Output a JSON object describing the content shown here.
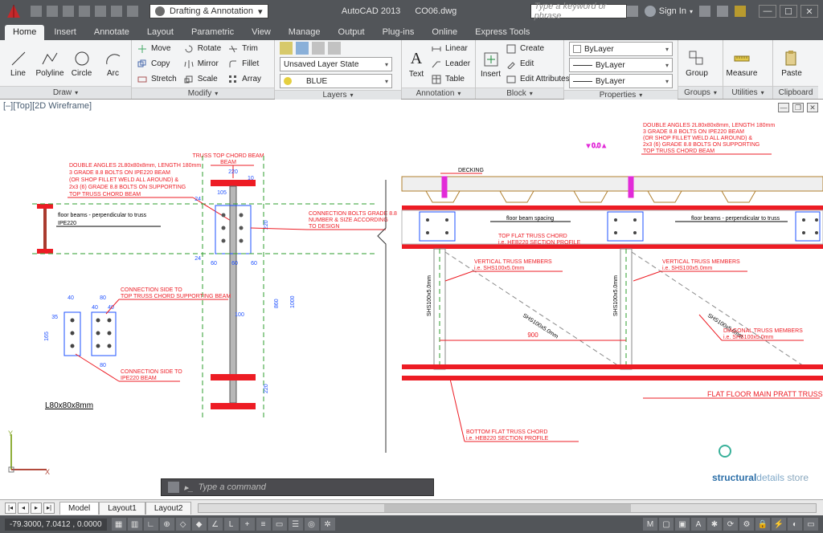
{
  "app": {
    "name": "AutoCAD 2013",
    "file": "CO06.dwg"
  },
  "workspace": {
    "label": "Drafting & Annotation"
  },
  "search": {
    "placeholder": "Type a keyword or phrase"
  },
  "signin": {
    "label": "Sign In"
  },
  "tabs": [
    "Home",
    "Insert",
    "Annotate",
    "Layout",
    "Parametric",
    "View",
    "Manage",
    "Output",
    "Plug-ins",
    "Online",
    "Express Tools"
  ],
  "active_tab": 0,
  "ribbon": {
    "draw": {
      "title": "Draw",
      "items": [
        "Line",
        "Polyline",
        "Circle",
        "Arc"
      ]
    },
    "modify": {
      "title": "Modify",
      "col1": [
        "Move",
        "Copy",
        "Stretch"
      ],
      "col2": [
        "Rotate",
        "Mirror",
        "Scale"
      ],
      "col3": [
        "Trim",
        "Fillet",
        "Array"
      ]
    },
    "layers": {
      "title": "Layers",
      "state": "Unsaved Layer State",
      "current": "BLUE",
      "swatch": "#1e50ff"
    },
    "annotation": {
      "title": "Annotation",
      "big": "Text",
      "rows": [
        "Linear",
        "Leader",
        "Table"
      ]
    },
    "block": {
      "title": "Block",
      "big": "Insert",
      "rows": [
        "Create",
        "Edit",
        "Edit Attributes"
      ]
    },
    "properties": {
      "title": "Properties",
      "combo1": "ByLayer",
      "combo2": "ByLayer",
      "combo3": "ByLayer"
    },
    "groups": {
      "title": "Groups",
      "big": "Group"
    },
    "utilities": {
      "title": "Utilities",
      "big": "Measure"
    },
    "clipboard": {
      "title": "Clipboard",
      "big": "Paste"
    }
  },
  "view": {
    "label": "[–][Top][2D Wireframe]"
  },
  "cmd": {
    "prompt": "Type a command"
  },
  "bottom_tabs": [
    "Model",
    "Layout1",
    "Layout2"
  ],
  "status": {
    "coords": "-79.3000, 7.0412 , 0.0000"
  },
  "drawing": {
    "left_notes": [
      "DOUBLE ANGLES 2L80x80x8mm, LENGTH 180mm",
      "3 GRADE 8.8 BOLTS ON IPE220 BEAM",
      "(OR SHOP FILLET WELD ALL AROUND) &",
      "2x3 (6) GRADE 8.8 BOLTS ON SUPPORTING",
      "TOP TRUSS CHORD BEAM"
    ],
    "right_notes": [
      "DOUBLE ANGLES 2L80x80x8mm, LENGTH 180mm",
      "3 GRADE 8.8 BOLTS ON IPE220 BEAM",
      "(OR SHOP FILLET WELD ALL AROUND) &",
      "2x3 (6) GRADE 8.8 BOLTS ON SUPPORTING",
      "TOP TRUSS CHORD BEAM"
    ],
    "truss_top": "TRUSS TOP CHORD BEAM",
    "conn_bolts": [
      "CONNECTION BOLTS GRADE 8.8",
      "NUMBER & SIZE ACCORDING",
      "TO DESIGN"
    ],
    "floor_beams": "floor beams - perpendicular to truss",
    "ipe": "IPE220",
    "conn_side_top": [
      "CONNECTION SIDE TO",
      "TOP TRUSS CHORD SUPPORTING BEAM"
    ],
    "conn_side_ipe": [
      "CONNECTION SIDE TO",
      "IPE220 BEAM"
    ],
    "angle_label": "L80x80x8mm",
    "decking": "DECKING",
    "floor_spacing": "floor beam spacing",
    "floor_perp": "floor beams - perpendicular to truss",
    "top_chord": [
      "TOP FLAT TRUSS CHORD",
      "i.e. HEB220 SECTION PROFILE"
    ],
    "vert_truss": [
      "VERTICAL TRUSS MEMBERS",
      "i.e. SHS100x5.0mm"
    ],
    "diag_truss": [
      "DIAGONAL TRUSS MEMBERS",
      "i.e. SHS100x5.0mm"
    ],
    "bottom_chord": [
      "BOTTOM FLAT TRUSS CHORD",
      "i.e. HEB220 SECTION PROFILE"
    ],
    "main_truss": "FLAT FLOOR MAIN PRATT TRUSS",
    "shs": "SHS100x5.0mm",
    "dims": {
      "d220": "220",
      "d10": "10",
      "d105": "105",
      "d24": "24",
      "d60": "60",
      "d100": "100",
      "d860": "860",
      "d1000": "1000",
      "d40": "40",
      "d80": "80",
      "d165": "165",
      "d35": "35",
      "d900": "900"
    },
    "watermark": {
      "a": "structural",
      "b": "details",
      "c": " store"
    }
  }
}
